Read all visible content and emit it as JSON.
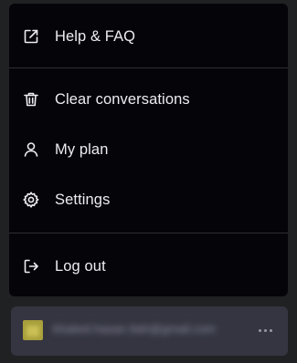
{
  "menu": {
    "items": [
      {
        "label": "Help & FAQ",
        "icon": "external-link-icon"
      },
      {
        "label": "Clear conversations",
        "icon": "trash-icon"
      },
      {
        "label": "My plan",
        "icon": "user-icon"
      },
      {
        "label": "Settings",
        "icon": "gear-icon"
      },
      {
        "label": "Log out",
        "icon": "log-out-icon"
      }
    ]
  },
  "user": {
    "name": "khaleel.hasan.9ah@gmail.com",
    "avatar_color": "#a89f3c",
    "more_icon": "ellipsis-icon"
  },
  "colors": {
    "background": "#202123",
    "menu_background": "#050509",
    "user_bar_background": "#343541",
    "text": "#ececf1"
  }
}
